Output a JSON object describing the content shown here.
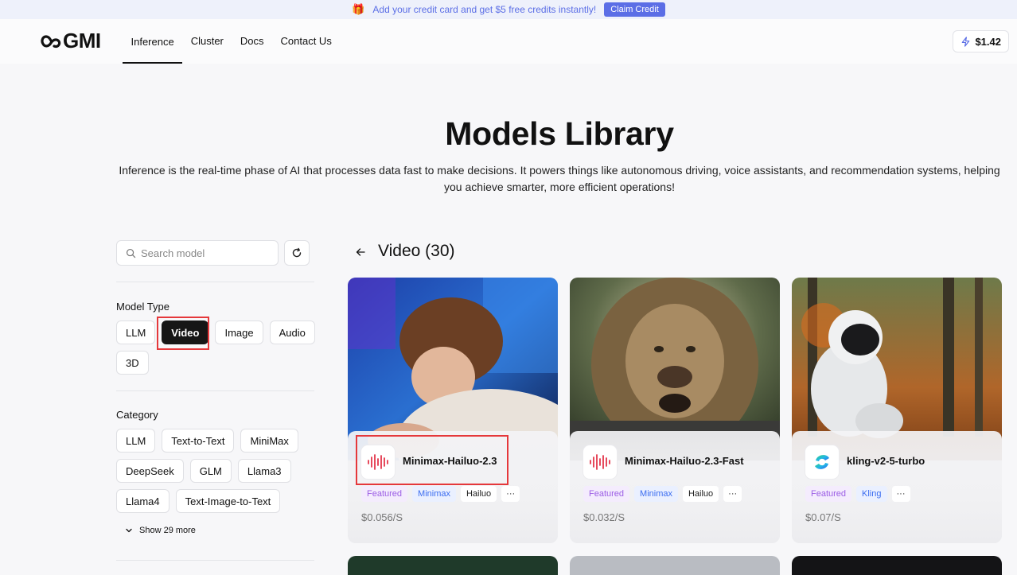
{
  "promo": {
    "text": "Add your credit card and get $5 free credits instantly!",
    "button": "Claim Credit"
  },
  "header": {
    "logo": "GMI",
    "nav": [
      "Inference",
      "Cluster",
      "Docs",
      "Contact Us"
    ],
    "active_nav": "Inference",
    "credits": "$1.42"
  },
  "hero": {
    "title": "Models Library",
    "description": "Inference is the real-time phase of AI that processes data fast to make decisions. It powers things like autonomous driving, voice assistants, and recommendation systems, helping you achieve smarter, more efficient operations!"
  },
  "sidebar": {
    "search_placeholder": "Search model",
    "model_type_label": "Model Type",
    "model_types": [
      "LLM",
      "Video",
      "Image",
      "Audio",
      "3D"
    ],
    "selected_type": "Video",
    "category_label": "Category",
    "categories": [
      "LLM",
      "Text-to-Text",
      "MiniMax",
      "DeepSeek",
      "GLM",
      "Llama3",
      "Llama4",
      "Text-Image-to-Text"
    ],
    "show_more": "Show 29 more"
  },
  "main": {
    "section_title": "Video (30)",
    "cards": [
      {
        "name": "Minimax-Hailuo-2.3",
        "tags": [
          "Featured",
          "Minimax",
          "Hailuo",
          "···"
        ],
        "price": "$0.056/S",
        "icon": "soundwave-icon"
      },
      {
        "name": "Minimax-Hailuo-2.3-Fast",
        "tags": [
          "Featured",
          "Minimax",
          "Hailuo",
          "···"
        ],
        "price": "$0.032/S",
        "icon": "soundwave-icon"
      },
      {
        "name": "kling-v2-5-turbo",
        "tags": [
          "Featured",
          "Kling",
          "···"
        ],
        "price": "$0.07/S",
        "icon": "kling-logo-icon"
      }
    ]
  },
  "colors": {
    "accent": "#5b6ee6",
    "highlight": "#e5383b",
    "featured": "#9b5de5",
    "brand_tag": "#3a6cf0"
  }
}
